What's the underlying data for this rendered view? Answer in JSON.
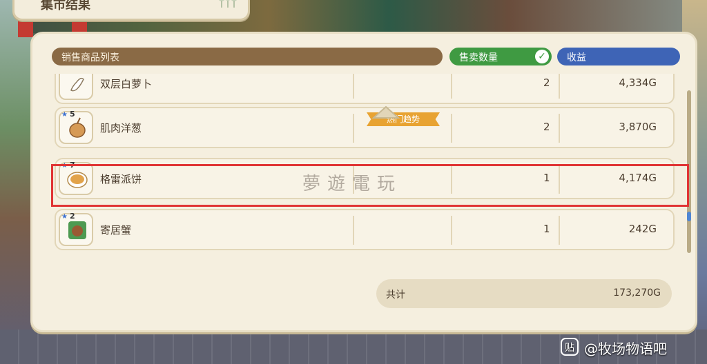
{
  "window": {
    "title": "集市结果"
  },
  "header": {
    "items_label": "销售商品列表",
    "qty_label": "售卖数量",
    "income_label": "收益"
  },
  "rows": [
    {
      "name": "双层白萝卜",
      "stars": "",
      "qty": "2",
      "income": "4,334G",
      "icon": "radish-icon"
    },
    {
      "name": "肌肉洋葱",
      "stars": "5",
      "qty": "2",
      "income": "3,870G",
      "icon": "onion-icon",
      "badge": "热门趋势"
    },
    {
      "name": "格雷派饼",
      "stars": "7",
      "qty": "1",
      "income": "4,174G",
      "icon": "pie-icon"
    },
    {
      "name": "寄居蟹",
      "stars": "2",
      "qty": "1",
      "income": "242G",
      "icon": "hermit-crab-icon"
    }
  ],
  "total": {
    "label": "共计",
    "value": "173,270G"
  },
  "watermark": "夢遊電玩",
  "tieba": {
    "icon": "贴",
    "text": "@牧场物语吧"
  },
  "colors": {
    "qty_header": "#3f9a42",
    "income_header": "#3e64b6",
    "items_header": "#8a6a45",
    "highlight": "#e03434",
    "badge": "#e8a332"
  }
}
